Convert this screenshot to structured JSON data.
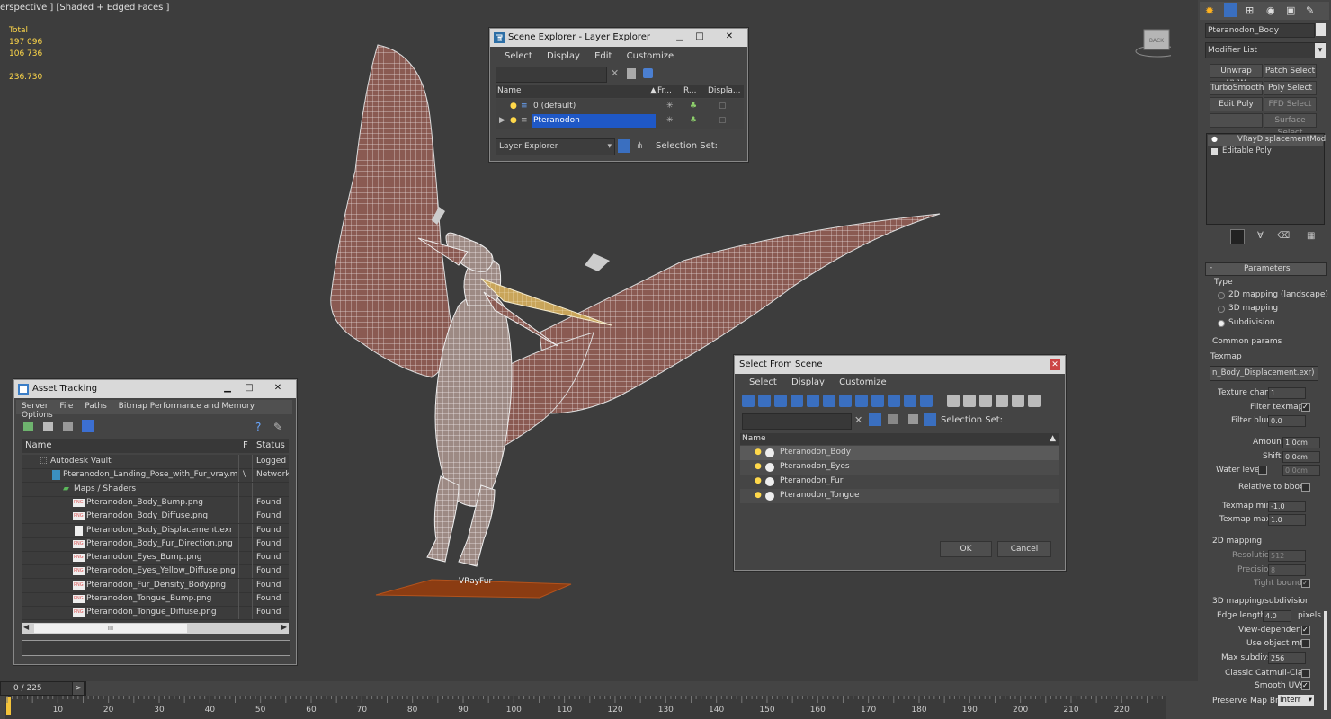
{
  "viewport": {
    "label": "erspective ] [Shaded + Edged Faces ]",
    "stats": [
      "Total",
      "197 096",
      "106 736",
      "",
      "236.730"
    ],
    "vrayfur_label": "VRayFur",
    "viewcube_label": "BACK"
  },
  "scene_explorer": {
    "title": "Scene Explorer - Layer Explorer",
    "menu": [
      "Select",
      "Display",
      "Edit",
      "Customize"
    ],
    "columns": [
      "Name",
      "Fr...",
      "R...",
      "Displa..."
    ],
    "rows": [
      "0 (default)",
      "Pteranodon"
    ],
    "layer_dropdown": "Layer Explorer",
    "selection_set_label": "Selection Set:"
  },
  "asset_tracking": {
    "title": "Asset Tracking",
    "menu": [
      "Server",
      "File",
      "Paths",
      "Bitmap Performance and Memory",
      "Options"
    ],
    "columns": [
      "Name",
      "F",
      "Status"
    ],
    "rows": [
      {
        "name": "Autodesk Vault",
        "f": "",
        "status": "Logged"
      },
      {
        "name": "Pteranodon_Landing_Pose_with_Fur_vray.m...",
        "f": "\\",
        "status": "Network"
      },
      {
        "name": "Maps / Shaders",
        "f": "",
        "status": ""
      },
      {
        "name": "Pteranodon_Body_Bump.png",
        "f": "",
        "status": "Found"
      },
      {
        "name": "Pteranodon_Body_Diffuse.png",
        "f": "",
        "status": "Found"
      },
      {
        "name": "Pteranodon_Body_Displacement.exr",
        "f": "",
        "status": "Found"
      },
      {
        "name": "Pteranodon_Body_Fur_Direction.png",
        "f": "",
        "status": "Found"
      },
      {
        "name": "Pteranodon_Eyes_Bump.png",
        "f": "",
        "status": "Found"
      },
      {
        "name": "Pteranodon_Eyes_Yellow_Diffuse.png",
        "f": "",
        "status": "Found"
      },
      {
        "name": "Pteranodon_Fur_Density_Body.png",
        "f": "",
        "status": "Found"
      },
      {
        "name": "Pteranodon_Tongue_Bump.png",
        "f": "",
        "status": "Found"
      },
      {
        "name": "Pteranodon_Tongue_Diffuse.png",
        "f": "",
        "status": "Found"
      }
    ],
    "png_badge": "PNG",
    "scroll_label": "III"
  },
  "select_from_scene": {
    "title": "Select From Scene",
    "menu": [
      "Select",
      "Display",
      "Customize"
    ],
    "selection_set_label": "Selection Set:",
    "column": "Name",
    "rows": [
      "Pteranodon_Body",
      "Pteranodon_Eyes",
      "Pteranodon_Fur",
      "Pteranodon_Tongue"
    ],
    "ok": "OK",
    "cancel": "Cancel"
  },
  "modifier_panel": {
    "object_name": "Pteranodon_Body",
    "modifier_list": "Modifier List",
    "buttons": [
      "Unwrap UVW",
      "Patch Select",
      "TurboSmooth",
      "Poly Select",
      "Edit Poly",
      "FFD Select",
      "",
      "Surface Select"
    ],
    "stack": [
      "VRayDisplacementMod",
      "Editable Poly"
    ],
    "rollout_title": "Parameters",
    "type_label": "Type",
    "type_options": [
      "2D mapping (landscape)",
      "3D mapping",
      "Subdivision"
    ],
    "common_params": "Common params",
    "texmap_label": "Texmap",
    "texmap_value": "n_Body_Displacement.exr)",
    "texture_chan_label": "Texture chan",
    "texture_chan_value": "1",
    "filter_texmap": "Filter texmap",
    "filter_blur_label": "Filter blur",
    "filter_blur_value": "0.0",
    "amount_label": "Amount",
    "amount_value": "1.0cm",
    "shift_label": "Shift",
    "shift_value": "0.0cm",
    "water_level_label": "Water level",
    "water_level_value": "0.0cm",
    "relative_bbox": "Relative to bbox",
    "texmap_min_label": "Texmap min",
    "texmap_min_value": "-1.0",
    "texmap_max_label": "Texmap max",
    "texmap_max_value": "1.0",
    "mapping2d": "2D mapping",
    "resolution_label": "Resolution",
    "resolution_value": "512",
    "precision_label": "Precision",
    "precision_value": "8",
    "tight_bounds": "Tight bounds",
    "mapping3d": "3D mapping/subdivision",
    "edge_length_label": "Edge length",
    "edge_length_value": "4.0",
    "pixels_label": "pixels",
    "view_dependent": "View-dependent",
    "use_object_mtl": "Use object mtl",
    "max_subdivs_label": "Max subdivs",
    "max_subdivs_value": "256",
    "classic_catmull": "Classic Catmull-Clark",
    "smooth_uvs": "Smooth UVs",
    "preserve_map_label": "Preserve Map Bnd",
    "preserve_map_value": "Interr"
  },
  "timeline": {
    "frame": "0 / 225",
    "arrow": ">",
    "ticks": [
      "10",
      "20",
      "30",
      "40",
      "50",
      "60",
      "70",
      "80",
      "90",
      "100",
      "110",
      "120",
      "130",
      "140",
      "150",
      "160",
      "170",
      "180",
      "190",
      "200",
      "210",
      "220"
    ]
  }
}
